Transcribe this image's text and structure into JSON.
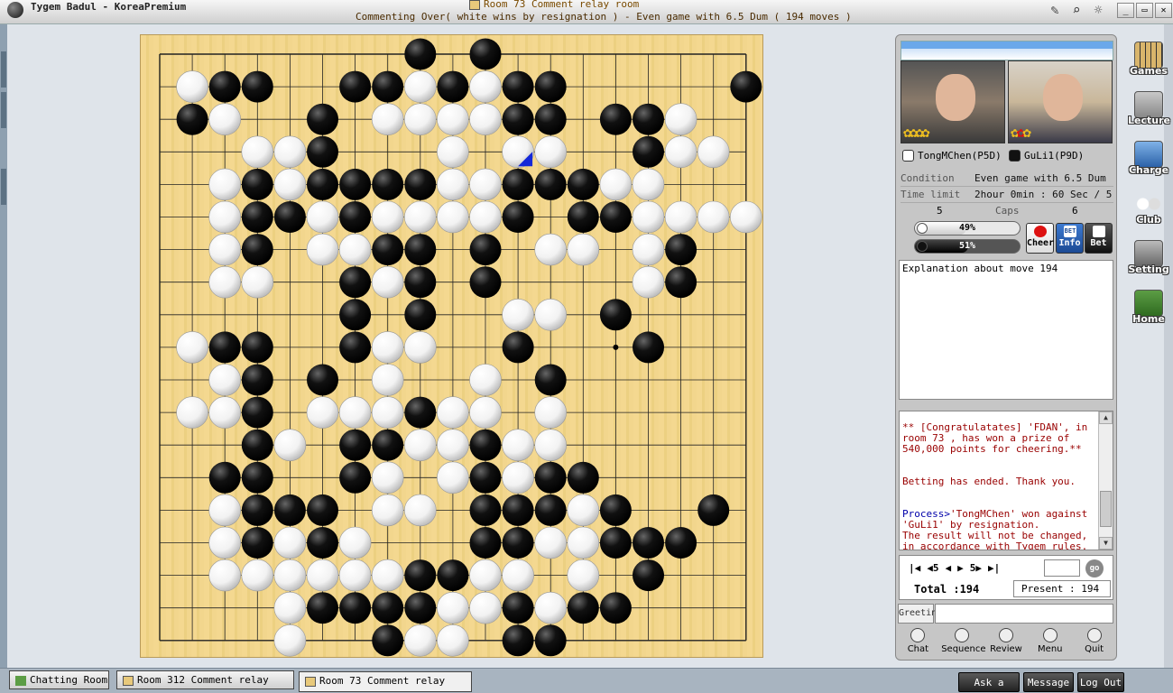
{
  "window": {
    "app_title": "Tygem Badul - KoreaPremium",
    "room_title": "Room 73 Comment relay room",
    "subtitle": "Commenting Over( white wins by resignation ) - Even game with 6.5 Dum  ( 194 moves )"
  },
  "players": {
    "white": {
      "name": "TongMChen(P5D)",
      "caps": "5",
      "win_pct": "49%",
      "win_value": 49
    },
    "black": {
      "name": "GuLi1(P9D)",
      "caps": "6",
      "win_pct": "51%",
      "win_value": 51
    }
  },
  "game_info": {
    "condition_label": "Condition",
    "condition_value": "Even game with 6.5 Dum",
    "time_label": "Time limit",
    "time_value": "2hour 0min : 60 Sec / 5",
    "caps_label": "Caps"
  },
  "actions": {
    "cheer": "Cheer",
    "info": "Info",
    "bet": "Bet",
    "info_icon": "BET"
  },
  "explanation": "Explanation about move 194",
  "chat": {
    "msg1": "** [Congratulatates] 'FDAN', in room 73 , has won a prize of 540,000 points for cheering.**",
    "msg2": "Betting has ended. Thank you.",
    "msg3_prefix": "Process>",
    "msg3": "'TongMChen' won against 'GuLi1' by resignation.",
    "msg4": "The result will not be changed, in accordance with Tygem rules."
  },
  "navigation": {
    "first": "|◀",
    "back5": "◀5",
    "prev": "◀",
    "next": "▶",
    "fwd5": "5▶",
    "last": "▶|",
    "go": "go",
    "total": "Total :194",
    "present": "Present : 194"
  },
  "greeting_label": "Greeting",
  "bottom_tools": [
    "Chat",
    "Sequence",
    "Review",
    "Menu",
    "Quit"
  ],
  "side_menu": [
    "Games",
    "Lecture",
    "Charge",
    "Club",
    "Setting",
    "Home"
  ],
  "taskbar": {
    "tabs": [
      "Chatting Room",
      "Room 312 Comment relay room",
      "Room 73 Comment relay room"
    ],
    "buttons": [
      "Ask a help",
      "Message",
      "Log Out"
    ]
  },
  "board": {
    "size": 19,
    "last_move": [
      11,
      3
    ],
    "star_points_shown": [
      [
        14,
        9
      ]
    ],
    "rows": [
      "........B.B........",
      ".WBB..BBWBWBB.....B",
      ".BW..B.WWWWBB.BBW..",
      "...WWB...W.WW..BWW.",
      "..WBWBBBBWWBBBWW...",
      "..WBBWBWWWWB.BBWWWW",
      "..WB.WWBB.B.WW.WB..",
      "..WW..BWB.B....WB..",
      "......B.B..WW.B....",
      ".WBB..BWW..B...B...",
      "..WB.B.W..W.B......",
      ".WWB.WWWBWW.W......",
      "...BW.BBWWBWW......",
      "..BB..BW.WBWBB.....",
      "..WBBB.WW.BBBWB..B.",
      "..WBWBW...BBWWBBB..",
      "..WWWWWWBBWW.W.B...",
      "....WBBBBWWBWBB....",
      "....W..BWW.BB......"
    ]
  }
}
